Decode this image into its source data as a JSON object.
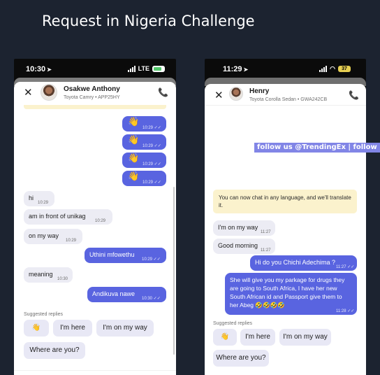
{
  "title": "Request in Nigeria Challenge",
  "watermark": "follow us @TrendingEx | follow us @TrendingEx",
  "left_phone": {
    "status": {
      "time": "10:30",
      "network": "LTE"
    },
    "header": {
      "name": "Osakwe Anthony",
      "car": "Toyota Camry • APP25HY"
    },
    "messages": [
      {
        "dir": "out",
        "text": "👋",
        "time": "10:29"
      },
      {
        "dir": "out",
        "text": "👋",
        "time": "10:29"
      },
      {
        "dir": "out",
        "text": "👋",
        "time": "10:29"
      },
      {
        "dir": "out",
        "text": "👋",
        "time": "10:29"
      },
      {
        "dir": "in",
        "text": "hi",
        "time": "10:29"
      },
      {
        "dir": "in",
        "text": "am in front of unikag",
        "time": "10:29"
      },
      {
        "dir": "in",
        "text": "on my way",
        "time": "10:29"
      },
      {
        "dir": "out",
        "text": "Uthini mfowethu",
        "time": "10:29"
      },
      {
        "dir": "in",
        "text": "meaning",
        "time": "10:30"
      },
      {
        "dir": "out",
        "text": "Andikuva nawe",
        "time": "10:30"
      }
    ],
    "suggested_label": "Suggested replies",
    "suggestions": [
      "👋",
      "I'm here",
      "I'm on my way",
      "Where are you?"
    ]
  },
  "right_phone": {
    "status": {
      "time": "11:29",
      "battery": "37"
    },
    "header": {
      "name": "Henry",
      "car": "Toyota Corolla Sedan • GWA242CB"
    },
    "notice": "You can now chat in any language, and we'll translate it.",
    "messages": [
      {
        "dir": "in",
        "text": "I'm on my way",
        "time": "11:27"
      },
      {
        "dir": "in",
        "text": "Good morning",
        "time": "11:27"
      },
      {
        "dir": "out",
        "text": "Hi do you Chichi Adechima ?",
        "time": "11:27"
      },
      {
        "dir": "out",
        "text": "She will give you my parkage for drugs they are going to South Africa, I have her new South African id and Passport give them to her Abeg 🤣🤣🤣🤣",
        "time": "11:28"
      }
    ],
    "suggested_label": "Suggested replies",
    "suggestions": [
      "👋",
      "I'm here",
      "I'm on my way",
      "Where are you?"
    ]
  }
}
